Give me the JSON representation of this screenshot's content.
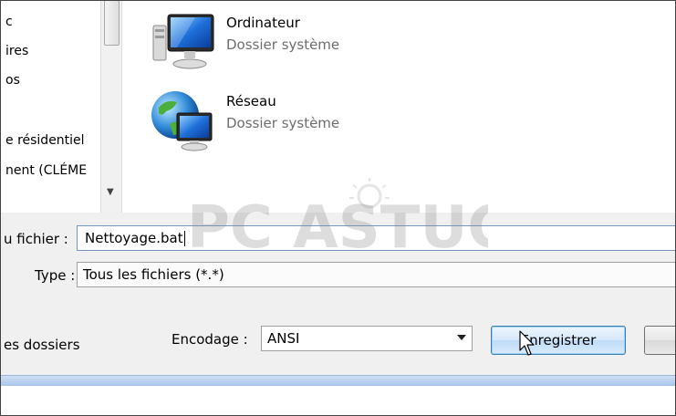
{
  "nav": {
    "items": [
      "c",
      "ires",
      "os",
      "e résidentiel",
      "nent (CLÉME"
    ]
  },
  "files": [
    {
      "name": "Ordinateur",
      "type": "Dossier système",
      "icon": "computer-icon"
    },
    {
      "name": "Réseau",
      "type": "Dossier système",
      "icon": "network-globe-icon"
    }
  ],
  "form": {
    "filename_label": "u fichier :",
    "filename_value": "Nettoyage.bat",
    "type_label": "Type :",
    "type_value": "Tous les fichiers  (*.*)",
    "hide_folders_label": "es dossiers",
    "encoding_label": "Encodage :",
    "encoding_value": "ANSI",
    "save_button": "Enregistrer"
  },
  "watermark": {
    "text": "PC ASTUCES"
  },
  "colors": {
    "accent": "#3c7fb1",
    "panel": "#f0f0f0",
    "strip": "#a9c4ea"
  }
}
